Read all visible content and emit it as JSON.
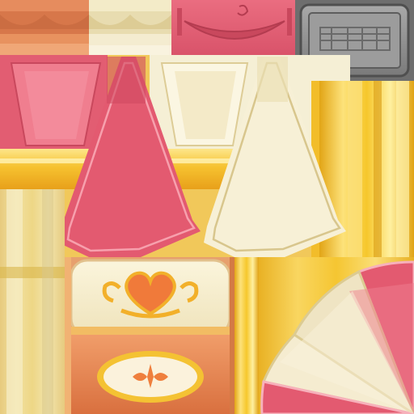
{
  "atlas": {
    "label": "",
    "colors": {
      "pink": "#e25d72",
      "pink_dark": "#c9485d",
      "pink_light": "#f07e8f",
      "cream": "#f4ecc9",
      "cream_dark": "#e4d5a6",
      "gold": "#f1c62b",
      "gold_light": "#fde27a",
      "gold_dark": "#d99b12",
      "orange": "#e98a57",
      "orange_dark": "#d36a3c",
      "gray": "#8a8a8a",
      "gray_dark": "#5e5e5e"
    },
    "tiles": [
      {
        "id": "scallop-trim-orange",
        "icon": "scallop-trim-icon"
      },
      {
        "id": "scallop-trim-cream",
        "icon": "scallop-trim-icon"
      },
      {
        "id": "swag-curtain-pink",
        "icon": "curtain-swag-icon"
      },
      {
        "id": "metal-vent-panel",
        "icon": "vent-grille-icon"
      },
      {
        "id": "pennant-pink",
        "icon": "pennant-icon"
      },
      {
        "id": "pennant-cream",
        "icon": "pennant-icon"
      },
      {
        "id": "gold-column",
        "icon": "column-icon"
      },
      {
        "id": "drape-pink",
        "icon": "drape-icon"
      },
      {
        "id": "drape-cream",
        "icon": "drape-icon"
      },
      {
        "id": "cream-stone-block",
        "icon": "block-icon"
      },
      {
        "id": "heart-crest-panel",
        "icon": "heart-icon"
      },
      {
        "id": "gold-trim-strip",
        "icon": "strip-icon"
      },
      {
        "id": "pie-fan",
        "icon": "fan-icon"
      }
    ]
  }
}
